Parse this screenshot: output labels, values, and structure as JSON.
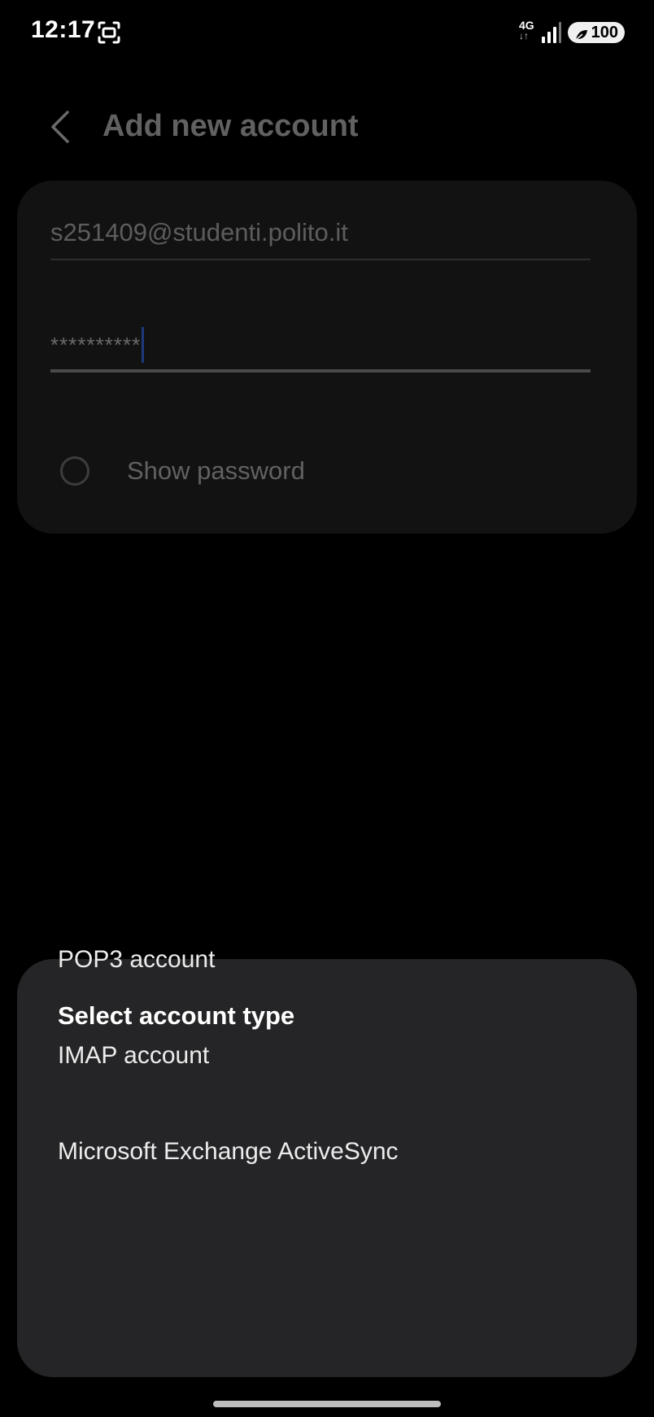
{
  "status_bar": {
    "time": "12:17",
    "network_type": "4G",
    "network_arrows": "↓↑",
    "battery_level": "100",
    "screenshot_icon": "screenshot-icon",
    "signal_icon": "signal-icon",
    "battery_saver_icon": "leaf-icon"
  },
  "header": {
    "back_icon": "chevron-left-icon",
    "title": "Add new account"
  },
  "form": {
    "email_value": "s251409@studenti.polito.it",
    "password_value": "**********",
    "show_password_label": "Show password",
    "show_password_checked": false
  },
  "account_type_sheet": {
    "title": "Select account type",
    "options": [
      {
        "label": "POP3 account"
      },
      {
        "label": "IMAP account"
      },
      {
        "label": "Microsoft Exchange ActiveSync"
      }
    ]
  },
  "colors": {
    "background": "#000000",
    "card": "#121212",
    "sheet": "#252527",
    "cursor": "#1d3a7a",
    "dimmed_text": "#616161"
  }
}
